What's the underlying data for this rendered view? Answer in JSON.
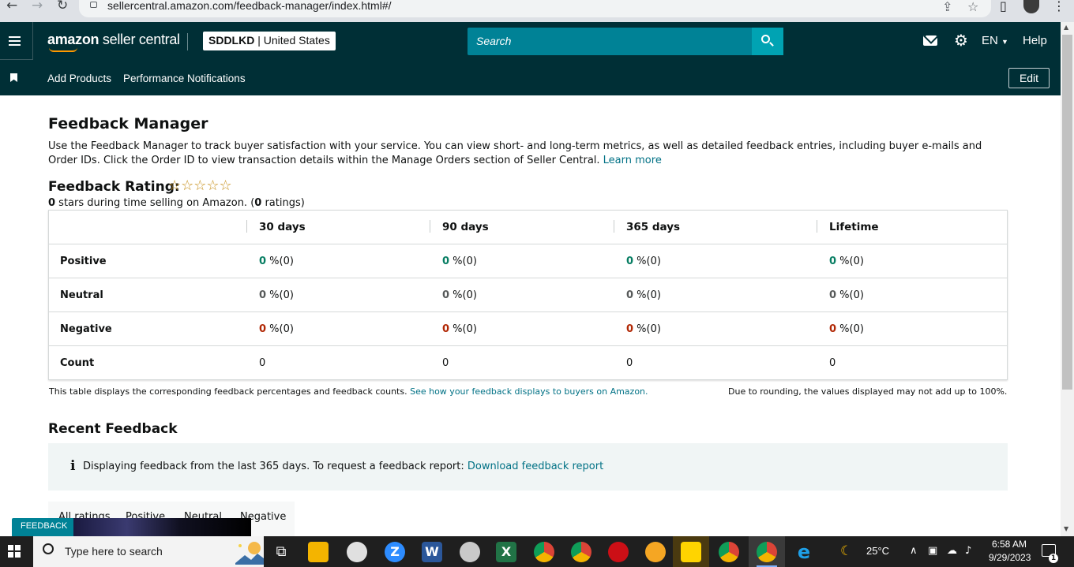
{
  "browser": {
    "url": "sellercentral.amazon.com/feedback-manager/index.html#/"
  },
  "header": {
    "logo_brand": "amazon",
    "logo_suffix": " seller central",
    "store_name": "SDDLKD",
    "store_separator": " | ",
    "store_country": "United States",
    "search_placeholder": "Search",
    "language": "EN",
    "help_label": "Help"
  },
  "subnav": {
    "links": [
      "Add Products",
      "Performance Notifications"
    ],
    "edit_label": "Edit"
  },
  "page": {
    "title": "Feedback Manager",
    "intro": "Use the Feedback Manager to track buyer satisfaction with your service. You can view short- and long-term metrics, as well as detailed feedback entries, including buyer e-mails and Order IDs. Click the Order ID to view transaction details within the Manage Orders section of Seller Central.",
    "intro_link": "Learn more",
    "rating_title": "Feedback Rating:",
    "stars": "☆☆☆☆☆",
    "stars_value": 0,
    "stars_max": 5,
    "summary_stars": "0",
    "summary_mid": " stars during time selling on Amazon. (",
    "summary_ratings": "0",
    "summary_end": " ratings)"
  },
  "feedback_table": {
    "columns": [
      "30 days",
      "90 days",
      "365 days",
      "Lifetime"
    ],
    "rows": [
      {
        "label": "Positive",
        "cells": [
          {
            "num": "0",
            "rest": " %(0)"
          },
          {
            "num": "0",
            "rest": " %(0)"
          },
          {
            "num": "0",
            "rest": " %(0)"
          },
          {
            "num": "0",
            "rest": " %(0)"
          }
        ]
      },
      {
        "label": "Neutral",
        "cells": [
          {
            "num": "0",
            "rest": " %(0)"
          },
          {
            "num": "0",
            "rest": " %(0)"
          },
          {
            "num": "0",
            "rest": " %(0)"
          },
          {
            "num": "0",
            "rest": " %(0)"
          }
        ]
      },
      {
        "label": "Negative",
        "cells": [
          {
            "num": "0",
            "rest": " %(0)"
          },
          {
            "num": "0",
            "rest": " %(0)"
          },
          {
            "num": "0",
            "rest": " %(0)"
          },
          {
            "num": "0",
            "rest": " %(0)"
          }
        ]
      },
      {
        "label": "Count",
        "cells": [
          {
            "num": "",
            "rest": "0"
          },
          {
            "num": "",
            "rest": "0"
          },
          {
            "num": "",
            "rest": "0"
          },
          {
            "num": "",
            "rest": "0"
          }
        ]
      }
    ],
    "footnote_left": "This table displays the corresponding feedback percentages and feedback counts.",
    "footnote_link": "See how your feedback displays to buyers on Amazon.",
    "footnote_right": "Due to rounding, the values displayed may not add up to 100%."
  },
  "recent": {
    "title": "Recent Feedback",
    "info_icon": "i",
    "info_text": "Displaying feedback from the last 365 days. To request a feedback report:",
    "info_link": "Download feedback report",
    "tabs": [
      "All ratings",
      "Positive",
      "Neutral",
      "Negative"
    ]
  },
  "feedback_tag": "FEEDBACK",
  "taskbar": {
    "search_placeholder": "Type here to search",
    "temperature": "25°C",
    "time": "6:58 AM",
    "date": "9/29/2023",
    "notification_count": "1"
  },
  "colors": {
    "nav_bg": "#002f36",
    "search_bg": "#008296",
    "link": "#007185",
    "positive": "#067d62",
    "negative": "#b12704"
  }
}
